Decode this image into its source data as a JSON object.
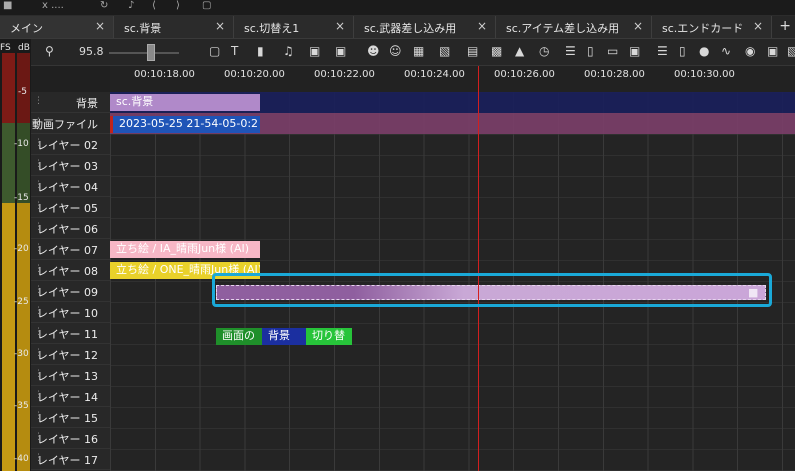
{
  "top_strip": {
    "frame_label": "x ...."
  },
  "tabs": [
    {
      "label": "メイン",
      "close": "×",
      "active": true
    },
    {
      "label": "sc.背景",
      "close": "×",
      "active": false
    },
    {
      "label": "sc.切替え1",
      "close": "×",
      "active": false
    },
    {
      "label": "sc.武器差し込み用",
      "close": "×",
      "active": false
    },
    {
      "label": "sc.アイテム差し込み用",
      "close": "×",
      "active": false
    },
    {
      "label": "sc.エンドカード",
      "close": "×",
      "active": false
    }
  ],
  "add_tab": "+",
  "meter": {
    "unit_left": "FS",
    "unit_right": "dB",
    "labels": [
      "-5",
      "-10",
      "-15",
      "-20",
      "-25",
      "-30",
      "-35",
      "-40"
    ],
    "colors": {
      "red": "#7e1b16",
      "green": "#3e5a2e",
      "yellow": "#c59a14"
    }
  },
  "toolbar": {
    "zoom_icon": "magnifier-icon",
    "zoom_value": "95.8",
    "zoom_slider_level": 0.55
  },
  "ruler": {
    "ticks": [
      "00:10:18.00",
      "00:10:20.00",
      "00:10:22.00",
      "00:10:24.00",
      "00:10:26.00",
      "00:10:28.00",
      "00:10:30.00"
    ]
  },
  "layers": [
    "背景",
    "動画ファイル",
    "レイヤー 02",
    "レイヤー 03",
    "レイヤー 04",
    "レイヤー 05",
    "レイヤー 06",
    "レイヤー 07",
    "レイヤー 08",
    "レイヤー 09",
    "レイヤー 10",
    "レイヤー 11",
    "レイヤー 12",
    "レイヤー 13",
    "レイヤー 14",
    "レイヤー 15",
    "レイヤー 16",
    "レイヤー 17"
  ],
  "clips": {
    "bg_scene": "sc.背景",
    "video_file": "2023-05-25 21-54-05-0:2",
    "tachie_1": "立ち絵 / IA_晴雨Jun様 (AI)",
    "tachie_2": "立ち絵 / ONE_晴雨Jun様 (AI)",
    "text_1": "画面の",
    "text_2": "背景",
    "text_3": "切り替"
  },
  "colors": {
    "bg_band": "#1a1f5c",
    "video_band": "#7c3f6a",
    "bg_clip": "#b089c9",
    "video_clip": "#1f54b7",
    "tachie_1": "#f7b7c6",
    "tachie_2": "#e9d12a",
    "effect_clip": "#8f5f9f",
    "selection": "#1aa9d8",
    "playhead": "#d21f1f",
    "text_green": "#1f8f2a",
    "text_blue": "#1b2fa0",
    "text_bright_green": "#27c43a"
  }
}
